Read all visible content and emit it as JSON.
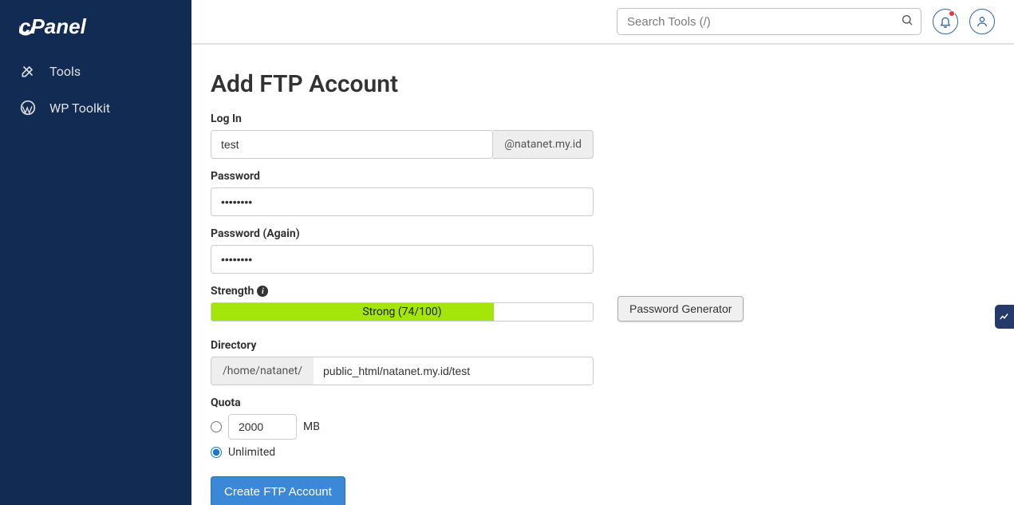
{
  "brand": "cPanel",
  "sidebar": {
    "items": [
      {
        "label": "Tools",
        "icon": "tools-icon"
      },
      {
        "label": "WP Toolkit",
        "icon": "wordpress-icon"
      }
    ]
  },
  "header": {
    "search_placeholder": "Search Tools (/)"
  },
  "page": {
    "title": "Add FTP Account",
    "login_label": "Log In",
    "login_value": "test",
    "login_domain": "@natanet.my.id",
    "password_label": "Password",
    "password_value": "••••••••",
    "password2_label": "Password (Again)",
    "password2_value": "••••••••",
    "strength_label": "Strength",
    "strength_text": "Strong (74/100)",
    "strength_pct": 74,
    "generator_btn": "Password Generator",
    "directory_label": "Directory",
    "directory_prefix": "/home/natanet/",
    "directory_value": "public_html/natanet.my.id/test",
    "quota_label": "Quota",
    "quota_size_value": "2000",
    "quota_size_unit": "MB",
    "quota_unlimited": "Unlimited",
    "submit_btn": "Create FTP Account"
  }
}
